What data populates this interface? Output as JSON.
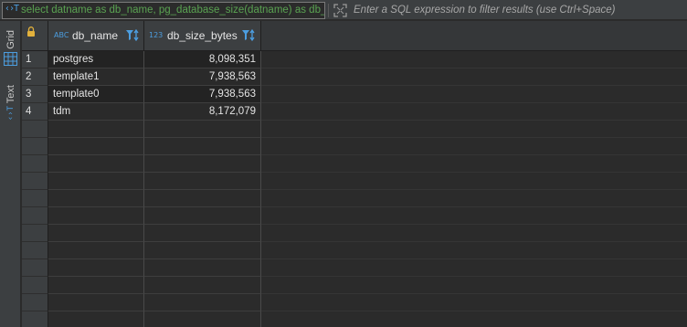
{
  "filter_bar": {
    "query_icon": "sql-text-icon",
    "query_text": "select datname as db_name, pg_database_size(datname) as db_size_bytes from pg_database",
    "expand_icon": "expand-icon",
    "filter_placeholder": "Enter a SQL expression to filter results (use Ctrl+Space)",
    "filter_value": ""
  },
  "side_panel": {
    "tabs": [
      {
        "label": "Grid",
        "icon": "grid-icon",
        "active": true
      },
      {
        "label": "Text",
        "icon": "text-icon",
        "active": false
      }
    ]
  },
  "grid": {
    "columns": [
      {
        "type_badge": "ABC",
        "name": "db_name",
        "icon": "filter-sort-icon"
      },
      {
        "type_badge": "123",
        "name": "db_size_bytes",
        "icon": "filter-sort-icon"
      }
    ],
    "rows": [
      {
        "num": "1",
        "db_name": "postgres",
        "db_size_bytes": "8,098,351"
      },
      {
        "num": "2",
        "db_name": "template1",
        "db_size_bytes": "7,938,563"
      },
      {
        "num": "3",
        "db_name": "template0",
        "db_size_bytes": "7,938,563"
      },
      {
        "num": "4",
        "db_name": "tdm",
        "db_size_bytes": "8,172,079"
      }
    ],
    "empty_row_count": 12
  },
  "colors": {
    "background": "#2b2b2b",
    "panel": "#3c3f41",
    "accent_blue": "#4c9ee0",
    "query_green": "#5aa352"
  }
}
